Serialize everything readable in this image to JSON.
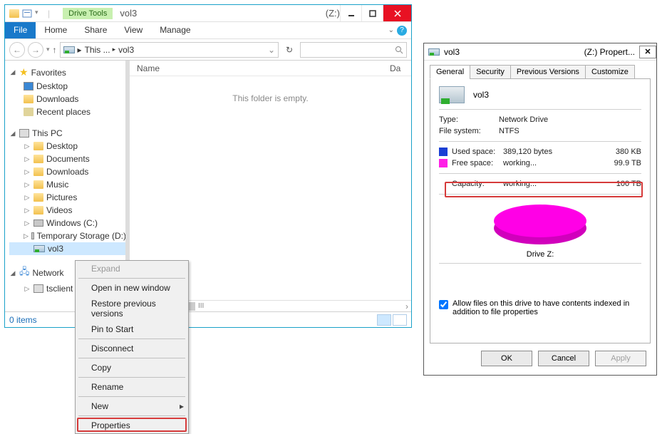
{
  "explorer": {
    "drive_tools_label": "Drive Tools",
    "title": "vol3",
    "drive_letter": "(Z:)",
    "tabs": {
      "file": "File",
      "home": "Home",
      "share": "Share",
      "view": "View",
      "manage": "Manage"
    },
    "breadcrumb": {
      "root": "This ...",
      "folder": "vol3"
    },
    "columns": {
      "name": "Name",
      "date": "Da"
    },
    "empty_msg": "This folder is empty.",
    "status_items": "0 items",
    "tree": {
      "favorites": "Favorites",
      "desktop": "Desktop",
      "downloads": "Downloads",
      "recent": "Recent places",
      "this_pc": "This PC",
      "pc_items": [
        "Desktop",
        "Documents",
        "Downloads",
        "Music",
        "Pictures",
        "Videos"
      ],
      "drives": [
        "Windows (C:)",
        "Temporary Storage (D:)"
      ],
      "vol3": "vol3",
      "network": "Network",
      "tsclient": "tsclient"
    },
    "scroll_label": "III"
  },
  "ctx": {
    "expand": "Expand",
    "open_new": "Open in new window",
    "restore": "Restore previous versions",
    "pin": "Pin to Start",
    "disconnect": "Disconnect",
    "copy": "Copy",
    "rename": "Rename",
    "new": "New",
    "properties": "Properties"
  },
  "props": {
    "title_volume": "vol3",
    "title_suffix": "(Z:) Propert...",
    "tabs": [
      "General",
      "Security",
      "Previous Versions",
      "Customize"
    ],
    "name": "vol3",
    "type_label": "Type:",
    "type": "Network Drive",
    "fs_label": "File system:",
    "fs": "NTFS",
    "used_label": "Used space:",
    "used_bytes": "389,120 bytes",
    "used_human": "380 KB",
    "free_label": "Free space:",
    "free_bytes": "working...",
    "free_human": "99.9 TB",
    "capacity_label": "Capacity:",
    "capacity_bytes": "working...",
    "capacity_human": "100 TB",
    "drive_z": "Drive Z:",
    "indexed": "Allow files on this drive to have contents indexed in addition to file properties",
    "btn_ok": "OK",
    "btn_cancel": "Cancel",
    "btn_apply": "Apply"
  }
}
